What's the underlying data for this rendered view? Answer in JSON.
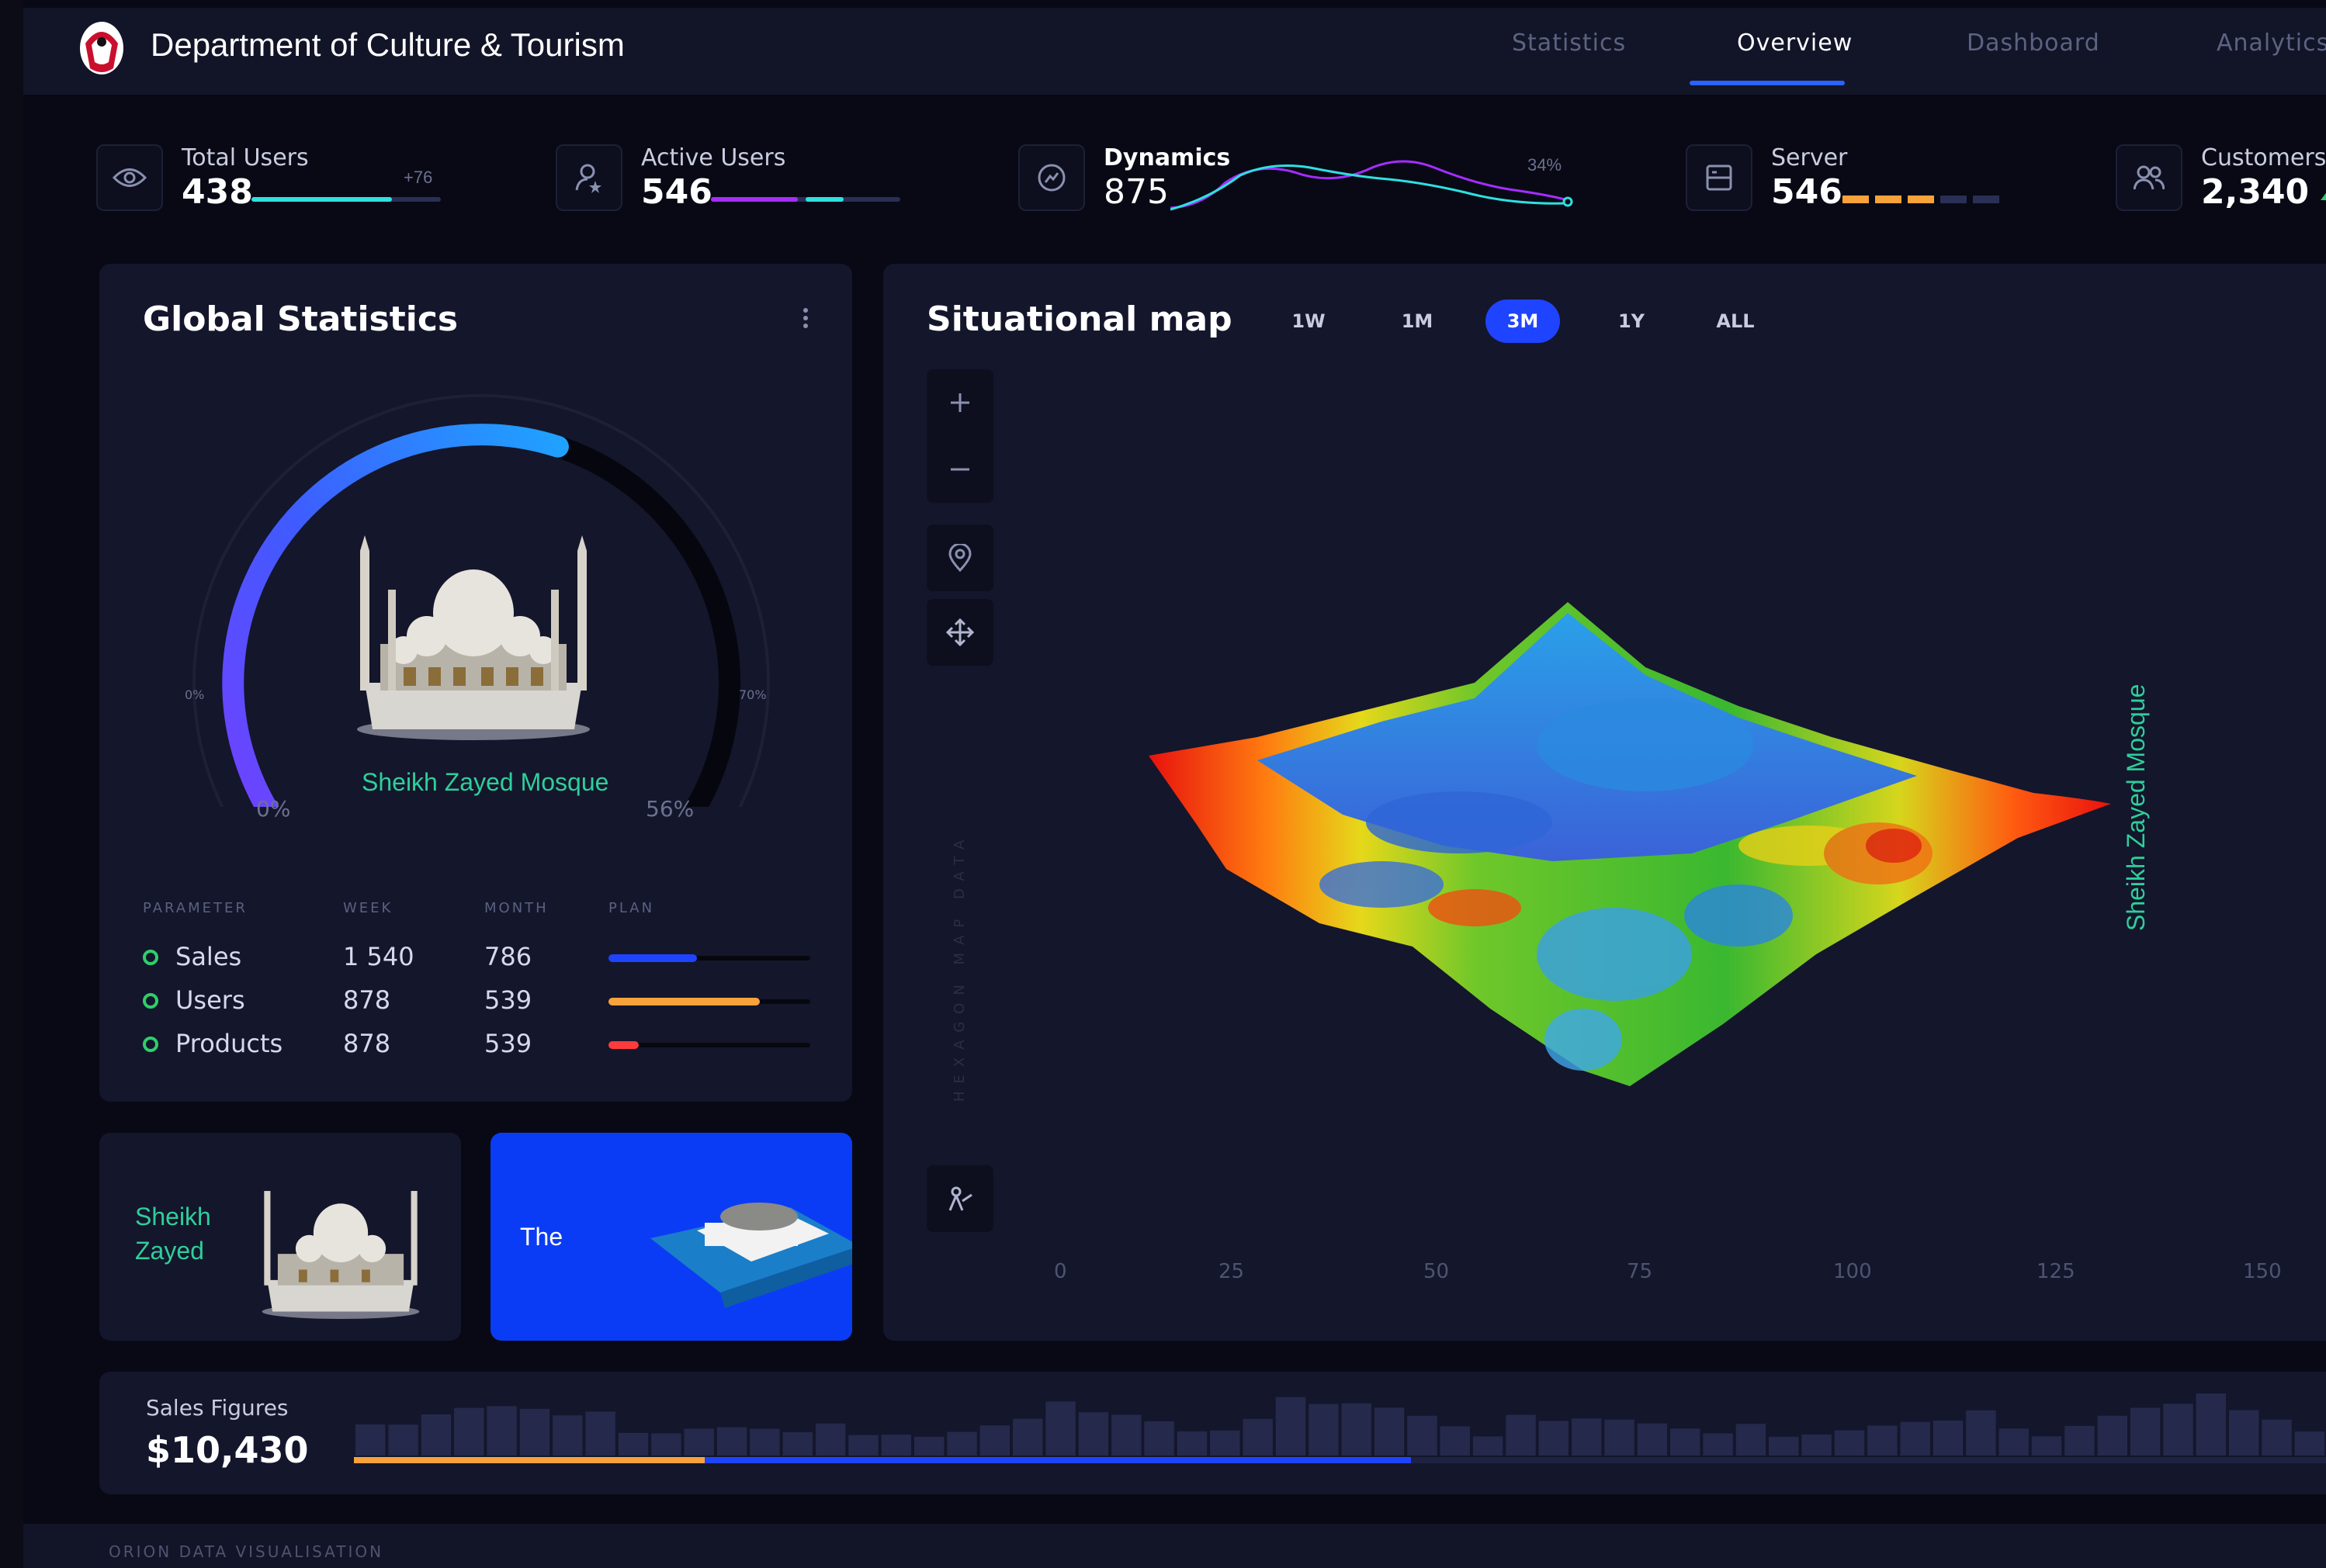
{
  "header": {
    "title": "Department of Culture & Tourism",
    "tabs": [
      {
        "label": "Statistics",
        "active": false
      },
      {
        "label": "Overview",
        "active": true
      },
      {
        "label": "Dashboard",
        "active": false
      },
      {
        "label": "Analytics",
        "active": false
      }
    ]
  },
  "kpis": {
    "total_users": {
      "label": "Total Users",
      "value": "438",
      "delta": "+76",
      "icon": "eye-icon"
    },
    "active_users": {
      "label": "Active Users",
      "value": "546",
      "icon": "user-star-icon"
    },
    "dynamics": {
      "label": "Dynamics",
      "value": "875",
      "pct": "34%",
      "icon": "trend-icon"
    },
    "server": {
      "label": "Server",
      "value": "546",
      "icon": "server-icon"
    },
    "customers": {
      "label": "Customers",
      "value": "2,340",
      "icon": "users-icon"
    }
  },
  "global_stats": {
    "title": "Global Statistics",
    "gauge_min": "0%",
    "gauge_max": "70%",
    "gauge_start": "0%",
    "gauge_value": "56%",
    "gauge_fraction": 0.56,
    "caption": "Sheikh Zayed Mosque",
    "table": {
      "headers": [
        "PARAMETER",
        "WEEK",
        "MONTH",
        "PLAN"
      ],
      "rows": [
        {
          "name": "Sales",
          "week": "1 540",
          "month": "786",
          "plan": 0.44,
          "color": "#1f44ff"
        },
        {
          "name": "Users",
          "week": "878",
          "month": "539",
          "plan": 0.75,
          "color": "#f7a23a"
        },
        {
          "name": "Products",
          "week": "878",
          "month": "539",
          "plan": 0.15,
          "color": "#ff3b3b"
        }
      ]
    }
  },
  "cards": {
    "mosque_card": "Sheikh\nZayed",
    "blue_card": "The"
  },
  "map": {
    "title": "Situational map",
    "ranges": [
      {
        "label": "1W",
        "active": false
      },
      {
        "label": "1M",
        "active": false
      },
      {
        "label": "3M",
        "active": true
      },
      {
        "label": "1Y",
        "active": false
      },
      {
        "label": "ALL",
        "active": false
      }
    ],
    "x_ticks": [
      "0",
      "25",
      "50",
      "75",
      "100",
      "125",
      "150"
    ],
    "side_label": "Sheikh Zayed Mosque",
    "faint_label": "HEXAGON MAP DATA"
  },
  "sales": {
    "label": "Sales Figures",
    "value": "$10,430"
  },
  "footer": {
    "text": "ORION DATA VISUALISATION"
  },
  "colors": {
    "accent_blue": "#1f44ff",
    "accent_teal": "#2ecf9a",
    "orange": "#f7a23a",
    "purple": "#a52dff"
  }
}
